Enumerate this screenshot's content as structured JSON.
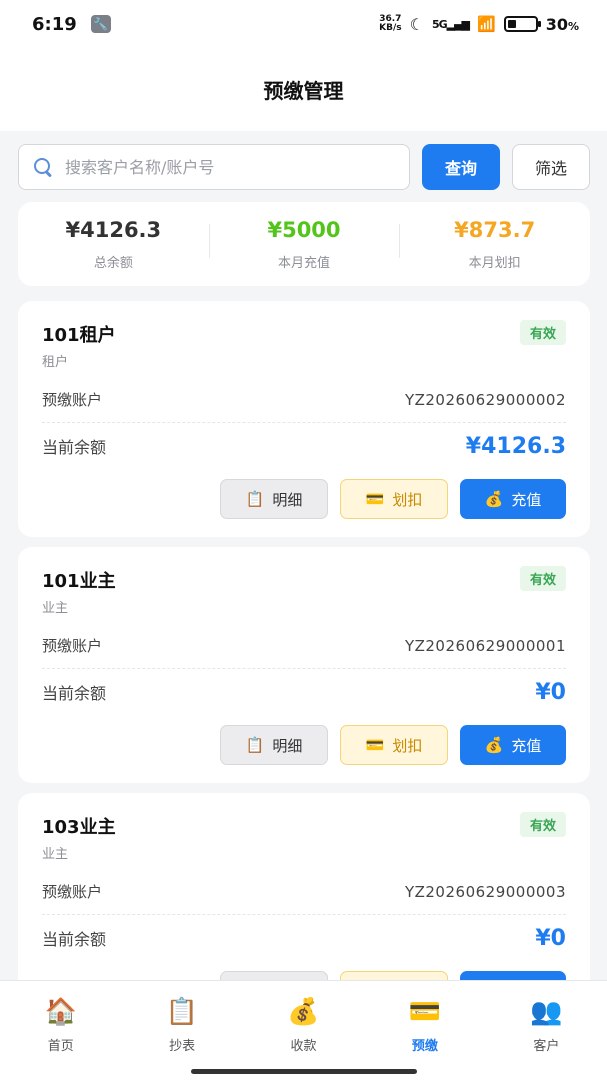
{
  "status_bar": {
    "time": "6:19",
    "net_speed_top": "36.7",
    "net_speed_unit": "KB/s",
    "signal": "5G",
    "battery_percent": 30,
    "battery_text": "30",
    "battery_unit": "%"
  },
  "header": {
    "title": "预缴管理"
  },
  "search": {
    "placeholder": "搜索客户名称/账户号",
    "query_label": "查询",
    "filter_label": "筛选"
  },
  "summary": {
    "items": [
      {
        "value": "¥4126.3",
        "label": "总余额",
        "color": "#333333"
      },
      {
        "value": "¥5000",
        "label": "本月充值",
        "color": "#52c41a"
      },
      {
        "value": "¥873.7",
        "label": "本月划扣",
        "color": "#f5a623"
      }
    ]
  },
  "labels": {
    "account": "预缴账户",
    "balance": "当前余额",
    "detail": "明细",
    "deduct": "划扣",
    "recharge": "充值"
  },
  "accounts": [
    {
      "name": "101租户",
      "type": "租户",
      "status": "有效",
      "account_no": "YZ20260629000002",
      "balance": "¥4126.3"
    },
    {
      "name": "101业主",
      "type": "业主",
      "status": "有效",
      "account_no": "YZ20260629000001",
      "balance": "¥0"
    },
    {
      "name": "103业主",
      "type": "业主",
      "status": "有效",
      "account_no": "YZ20260629000003",
      "balance": "¥0"
    }
  ],
  "tabbar": {
    "items": [
      {
        "label": "首页",
        "icon": "🏠"
      },
      {
        "label": "抄表",
        "icon": "📋"
      },
      {
        "label": "收款",
        "icon": "💰"
      },
      {
        "label": "预缴",
        "icon": "💳"
      },
      {
        "label": "客户",
        "icon": "👥"
      }
    ],
    "active_index": 3
  },
  "colors": {
    "primary": "#1f7cf0",
    "success": "#3aa655",
    "warning": "#c98a00"
  }
}
